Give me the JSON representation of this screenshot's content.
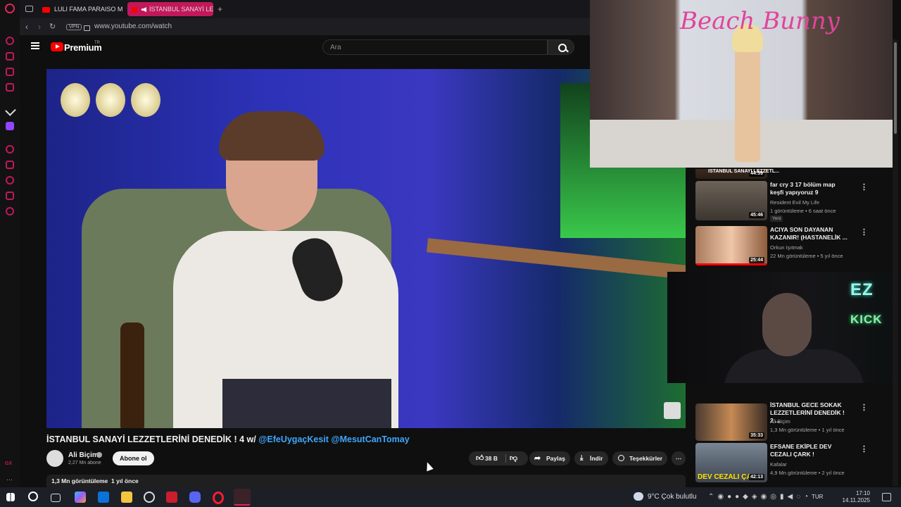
{
  "browser": {
    "tabs": [
      {
        "label": "LULI FAMA PARAISO Mia"
      },
      {
        "label": "İSTANBUL SANAYİ LE"
      }
    ],
    "new_tab_glyph": "+",
    "vpn_label": "VPN",
    "url": "www.youtube.com/watch",
    "rail_sidebar_label": "GX"
  },
  "youtube": {
    "logo_text": "Premium",
    "logo_country": "TR",
    "search_placeholder": "Ara"
  },
  "pip": {
    "fashion_title": "Beach Bunny",
    "cam_logo_top": "EZ",
    "cam_logo_bottom": "KICK"
  },
  "video": {
    "title_main": "İSTANBUL SANAYİ LEZZETLERİNİ DENEDİK ! 4 w/ ",
    "title_mentions": "@EfeUygaçKesit @MesutCanTomay",
    "channel": "Ali Biçim",
    "subscribers": "2,27 Mn abone",
    "subscribe_label": "Abone ol",
    "likes": "38 B",
    "share_label": "Paylaş",
    "download_label": "İndir",
    "thanks_label": "Teşekkürler",
    "views": "1,3 Mn görüntüleme",
    "age": "1 yıl önce"
  },
  "recommendations": [
    {
      "title": "İSTANBUL SANAYİ LEZZETL...",
      "duration": "44:59",
      "channel": "",
      "meta": ""
    },
    {
      "title": "far cry 3 17 bölüm map keşfi yapıyoruz 9",
      "duration": "45:46",
      "channel": "Resident Evil My Life",
      "meta": "1 görüntüleme • 6 saat önce",
      "badge": "Yeni"
    },
    {
      "title": "ACIYA SON DAYANAN KAZANIR! (HASTANELİK ...",
      "duration": "25:44",
      "channel": "Orkun Işıtmak",
      "meta": "22 Mn görüntüleme • 5 yıl önce"
    },
    {
      "title": "İSTANBUL GECE SOKAK LEZZETLERİNİ DENEDİK ! 2 ...",
      "duration": "35:33",
      "channel": "Ali Biçim",
      "meta": "1,3 Mn görüntüleme • 1 yıl önce"
    },
    {
      "title": "EFSANE EKİPLE DEV CEZALI ÇARK !",
      "duration": "42:13",
      "channel": "Kafalar",
      "meta": "4,9 Mn görüntüleme • 2 yıl önce",
      "thumb_text": "DEV CEZALI ÇA"
    }
  ],
  "taskbar": {
    "weather": "9°C  Çok bulutlu",
    "lang": "TUR",
    "time": "17:10",
    "date": "14.11.2025"
  }
}
